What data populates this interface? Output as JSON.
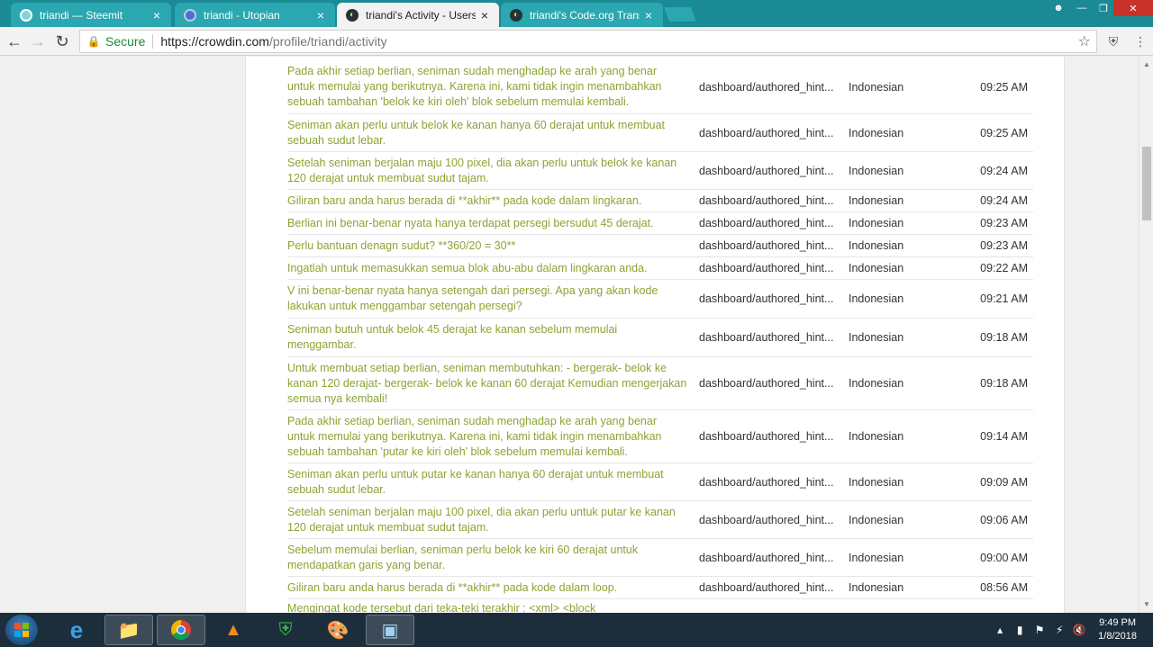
{
  "browser": {
    "tabs": [
      {
        "title": "triandi — Steemit",
        "icon": "steemit-icon",
        "active": false
      },
      {
        "title": "triandi - Utopian",
        "icon": "utopian-icon",
        "active": false
      },
      {
        "title": "triandi's Activity - Users a",
        "icon": "crowdin-icon",
        "active": true
      },
      {
        "title": "triandi's Code.org Transl",
        "icon": "crowdin-icon",
        "active": false
      }
    ],
    "close_glyph": "×",
    "secure_label": "Secure",
    "url_host": "https://crowdin.com",
    "url_path": "/profile/triandi/activity"
  },
  "activity": {
    "rows": [
      {
        "text": "Pada akhir setiap berlian, seniman sudah menghadap ke arah yang benar untuk memulai yang berikutnya. Karena ini, kami tidak ingin menambahkan sebuah tambahan 'belok ke kiri oleh' blok sebelum memulai kembali.",
        "file": "dashboard/authored_hint...",
        "lang": "Indonesian",
        "time": "09:25 AM"
      },
      {
        "text": "Seniman akan perlu untuk belok ke kanan hanya 60 derajat untuk membuat sebuah sudut lebar.",
        "file": "dashboard/authored_hint...",
        "lang": "Indonesian",
        "time": "09:25 AM"
      },
      {
        "text": "Setelah seniman berjalan maju 100 pixel, dia akan perlu untuk belok ke kanan 120 derajat untuk membuat sudut tajam.",
        "file": "dashboard/authored_hint...",
        "lang": "Indonesian",
        "time": "09:24 AM"
      },
      {
        "text": "Giliran baru anda harus berada di **akhir** pada kode dalam lingkaran.",
        "file": "dashboard/authored_hint...",
        "lang": "Indonesian",
        "time": "09:24 AM"
      },
      {
        "text": "Berlian ini benar-benar nyata hanya terdapat persegi bersudut 45 derajat.",
        "file": "dashboard/authored_hint...",
        "lang": "Indonesian",
        "time": "09:23 AM"
      },
      {
        "text": "Perlu bantuan denagn sudut? **360/20 = 30**",
        "file": "dashboard/authored_hint...",
        "lang": "Indonesian",
        "time": "09:23 AM"
      },
      {
        "text": "Ingatlah untuk memasukkan semua blok abu-abu dalam lingkaran anda.",
        "file": "dashboard/authored_hint...",
        "lang": "Indonesian",
        "time": "09:22 AM"
      },
      {
        "text": "V ini benar-benar nyata hanya setengah dari persegi. Apa yang akan kode lakukan untuk menggambar setengah persegi?",
        "file": "dashboard/authored_hint...",
        "lang": "Indonesian",
        "time": "09:21 AM"
      },
      {
        "text": "Seniman butuh untuk belok 45 derajat ke kanan sebelum memulai menggambar.",
        "file": "dashboard/authored_hint...",
        "lang": "Indonesian",
        "time": "09:18 AM"
      },
      {
        "text": "Untuk membuat setiap berlian, seniman membutuhkan: - bergerak- belok ke kanan 120 derajat- bergerak- belok ke kanan 60 derajat Kemudian mengerjakan semua nya kembali!",
        "file": "dashboard/authored_hint...",
        "lang": "Indonesian",
        "time": "09:18 AM"
      },
      {
        "text": "Pada akhir setiap berlian, seniman sudah menghadap ke arah yang benar untuk memulai yang berikutnya. Karena ini, kami tidak ingin menambahkan sebuah tambahan 'putar ke kiri oleh' blok sebelum memulai kembali.",
        "file": "dashboard/authored_hint...",
        "lang": "Indonesian",
        "time": "09:14 AM"
      },
      {
        "text": "Seniman akan perlu untuk putar ke kanan hanya 60 derajat untuk membuat sebuah sudut lebar.",
        "file": "dashboard/authored_hint...",
        "lang": "Indonesian",
        "time": "09:09 AM"
      },
      {
        "text": "Setelah seniman berjalan maju 100 pixel, dia akan perlu untuk putar ke kanan 120 derajat untuk membuat sudut tajam.",
        "file": "dashboard/authored_hint...",
        "lang": "Indonesian",
        "time": "09:06 AM"
      },
      {
        "text": "Sebelum memulai berlian, seniman perlu belok ke kiri 60 derajat untuk mendapatkan garis yang benar.",
        "file": "dashboard/authored_hint...",
        "lang": "Indonesian",
        "time": "09:00 AM"
      },
      {
        "text": "Giliran baru anda harus berada di **akhir** pada kode dalam loop.",
        "file": "dashboard/authored_hint...",
        "lang": "Indonesian",
        "time": "08:56 AM"
      },
      {
        "text": "Mengingat kode tersebut dari teka-teki terakhir : <xml> <block",
        "file": "",
        "lang": "",
        "time": ""
      }
    ]
  },
  "taskbar": {
    "clock_time": "9:49 PM",
    "clock_date": "1/8/2018"
  },
  "colors": {
    "tab_strip": "#1a8a94",
    "translation_text": "#8aa534",
    "secure_green": "#1d8b3a"
  }
}
